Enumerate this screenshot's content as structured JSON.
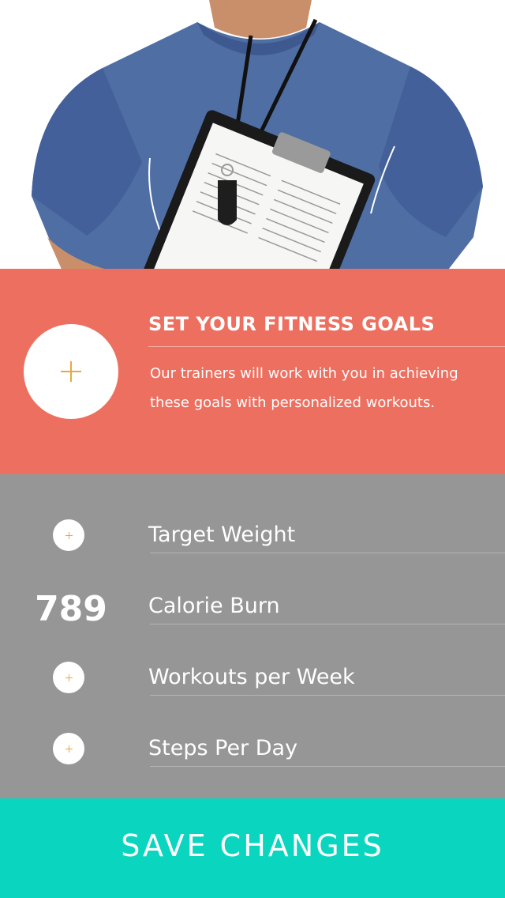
{
  "goal": {
    "title": "SET YOUR FITNESS GOALS",
    "description": "Our trainers will work with you in achieving these goals with personalized workouts."
  },
  "metrics": [
    {
      "label": "Target Weight",
      "value": ""
    },
    {
      "label": "Calorie Burn",
      "value": "789"
    },
    {
      "label": "Workouts per Week",
      "value": ""
    },
    {
      "label": "Steps Per Day",
      "value": ""
    }
  ],
  "save_label": "SAVE CHANGES",
  "colors": {
    "goal_bg": "#ec6f5f",
    "metrics_bg": "#969696",
    "save_bg": "#0ad6bf",
    "plus_accent": "#e8a93b"
  },
  "icons": [
    "plus-icon",
    "whistle-icon",
    "clipboard-icon"
  ]
}
